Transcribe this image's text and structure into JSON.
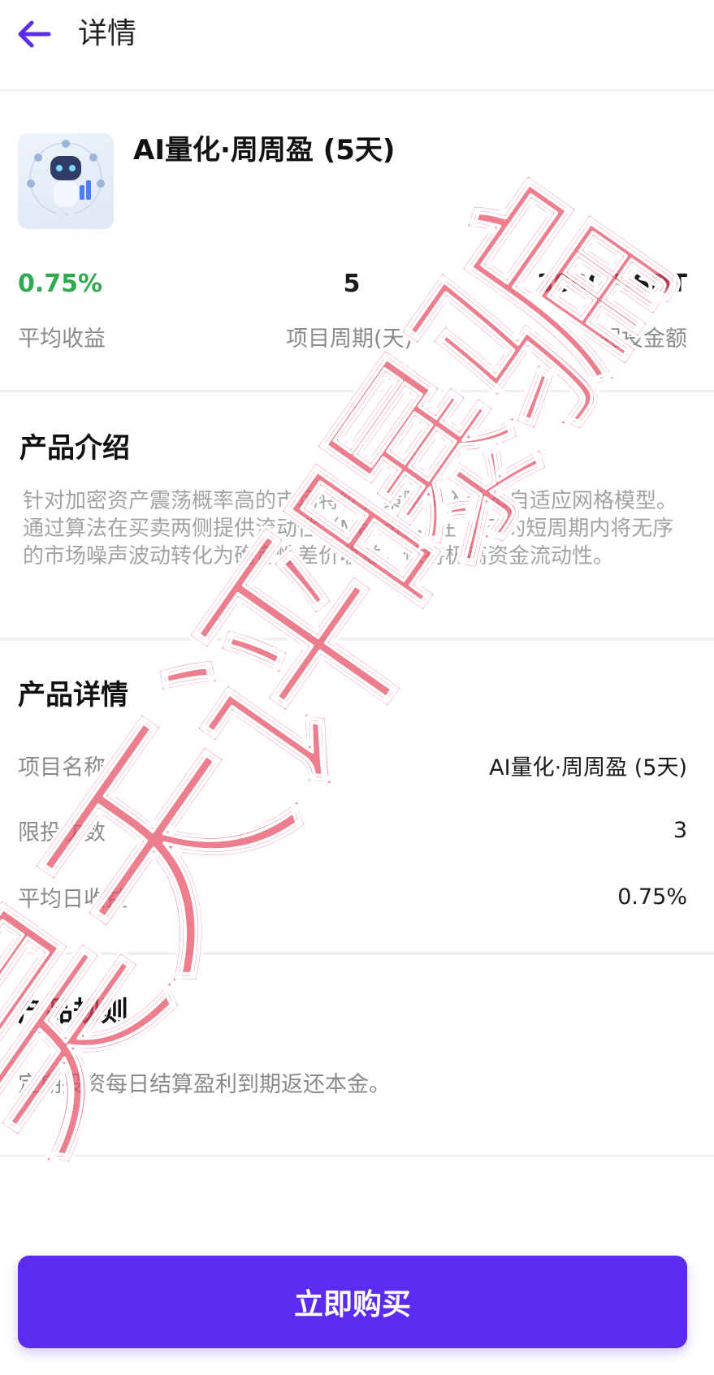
{
  "header": {
    "back_icon": "arrow-left-icon",
    "title": "详情",
    "accent_color": "#5b2cf0"
  },
  "product": {
    "image_icon": "ai-robot-illustration",
    "title": "AI量化·周周盈 (5天)"
  },
  "stats": [
    {
      "value": "0.75%",
      "label": "平均收益",
      "color": "#2eaa4f"
    },
    {
      "value": "5",
      "label": "项目周期(天)"
    },
    {
      "value": "3000 USDT",
      "label": "起投金额"
    }
  ],
  "intro": {
    "title": "产品介绍",
    "text": "针对加密资产震荡概率高的市场特征，策略引入动态自适应网格模型。通过算法在买卖两侧提供流动性（Maker），在 5 天的短周期内将无序的市场噪声波动转化为确定性差价收益，保持极高资金流动性。"
  },
  "details": {
    "title": "产品详情",
    "rows": [
      {
        "label": "项目名称",
        "value": "AI量化·周周盈 (5天)"
      },
      {
        "label": "限投次数",
        "value": "3"
      },
      {
        "label": "平均日收益",
        "value": "0.75%"
      }
    ]
  },
  "rules": {
    "title": "产品规则",
    "text": "定期投资每日结算盈利到期返还本金。"
  },
  "buy_button": {
    "label": "立即购买",
    "color": "#5b2cf0"
  },
  "watermark": {
    "text": "昊天评曝骗",
    "color": "#e0405a"
  }
}
